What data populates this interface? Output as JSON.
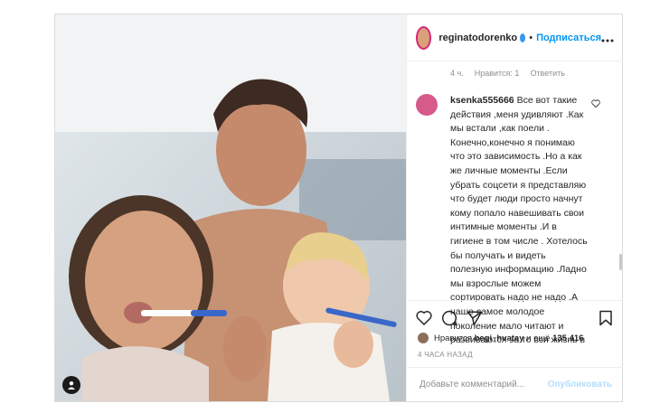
{
  "post": {
    "author": "reginatodorenko",
    "follow_label": "Подписаться",
    "separator": "•",
    "more_label": "•••"
  },
  "meta": {
    "age": "4 ч.",
    "likes": "Нравится: 1",
    "reply": "Ответить"
  },
  "comment": {
    "username": "ksenka555666",
    "text": "Все вот такие действия ,меня удивляют .Как мы встали ,как поели . Конечно,конечно я понимаю что это зависимость .Но а как же личные моменты .Если убрать соцсети я представляю что будет люди просто начнут кому попало навешивать свои интимные моменты .И в гигиене в том числе . Хотелось бы получать и видеть полезную информацию .Ладно мы взрослые можем сортировать надо не надо .А наше самое молодое поколение мало читают и развиваются за то вся жизнь в"
  },
  "likes": {
    "prefix": "Нравится",
    "user": "begi_hvatay",
    "middle": "и ещё",
    "count": "135 416"
  },
  "timestamp": "4 ЧАСА НАЗАД",
  "add_comment": {
    "placeholder": "Добавьте комментарий...",
    "publish_label": "Опубликовать"
  },
  "colors": {
    "accent": "#0095f6",
    "muted": "#8e8e8e",
    "border": "#dbdbdb"
  }
}
